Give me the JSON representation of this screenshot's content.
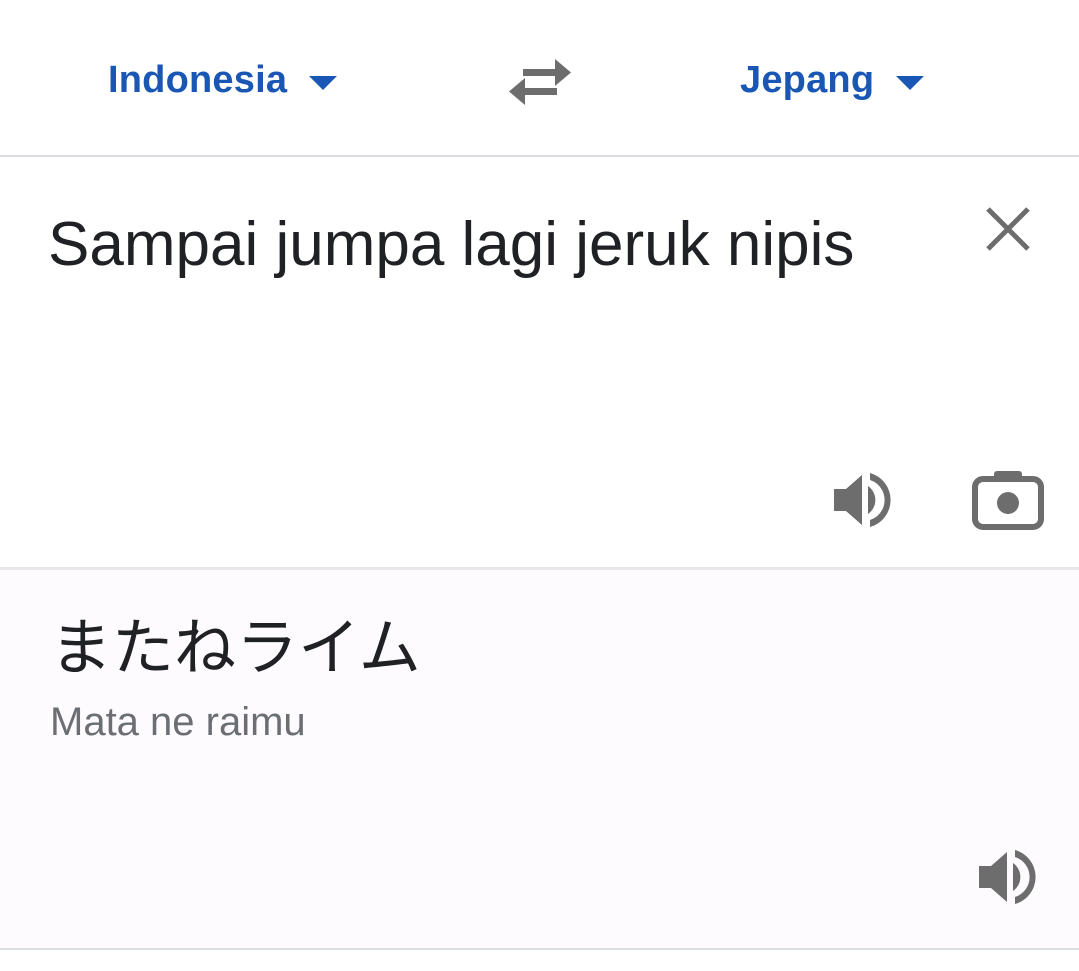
{
  "languages": {
    "source": "Indonesia",
    "target": "Jepang"
  },
  "input": {
    "text": "Sampai jumpa lagi jeruk nipis"
  },
  "output": {
    "text": "またねライム",
    "romanization": "Mata ne raimu"
  },
  "colors": {
    "accent": "#1a56b4",
    "icon": "#6d6d6d",
    "text": "#202124",
    "secondary_text": "#6b6e73"
  },
  "icons": {
    "swap": "swap-languages-icon",
    "clear": "close-icon",
    "speaker": "speaker-icon",
    "camera": "camera-icon",
    "caret": "caret-down-icon"
  }
}
